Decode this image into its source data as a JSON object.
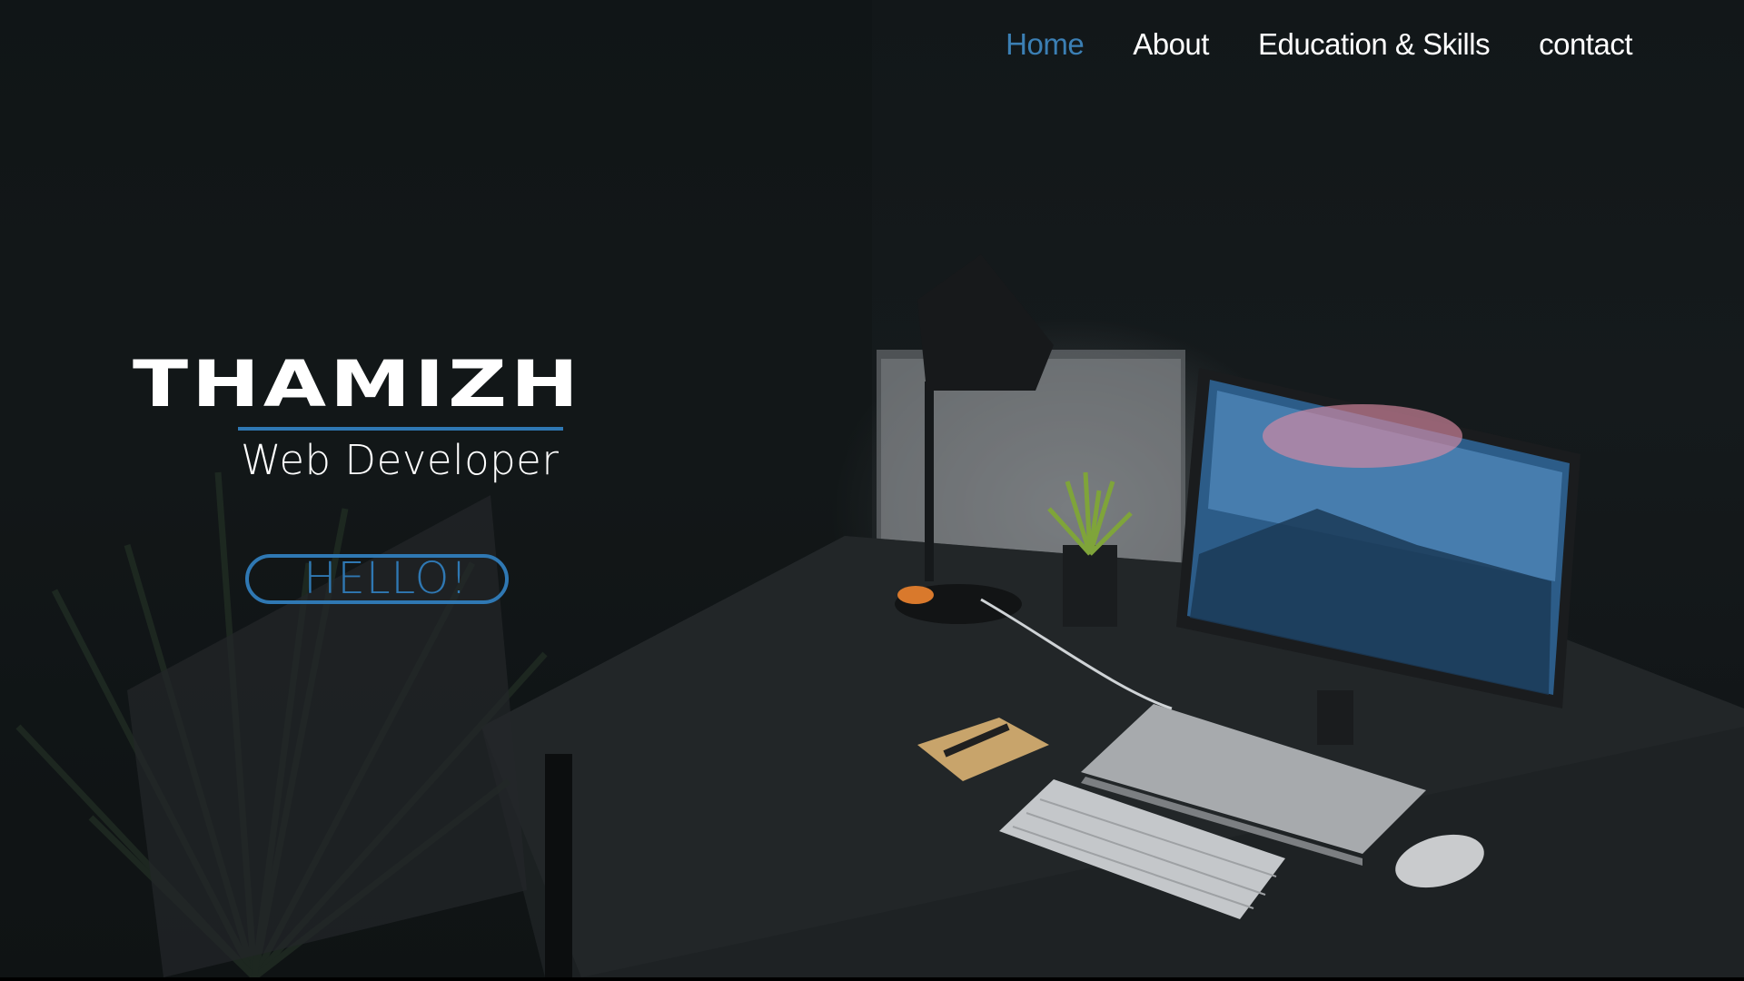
{
  "nav": {
    "items": [
      {
        "label": "Home",
        "active": true
      },
      {
        "label": "About",
        "active": false
      },
      {
        "label": "Education & Skills",
        "active": false
      },
      {
        "label": "contact",
        "active": false
      }
    ]
  },
  "hero": {
    "name": "THAMIZH",
    "role": "Web Developer",
    "cta_label": "HELLO!",
    "background_image": "dark-desk-workspace-photo"
  },
  "colors": {
    "accent": "#2f78b3",
    "nav_active": "#3b7fb4",
    "text": "#ffffff",
    "background": "#121719"
  }
}
